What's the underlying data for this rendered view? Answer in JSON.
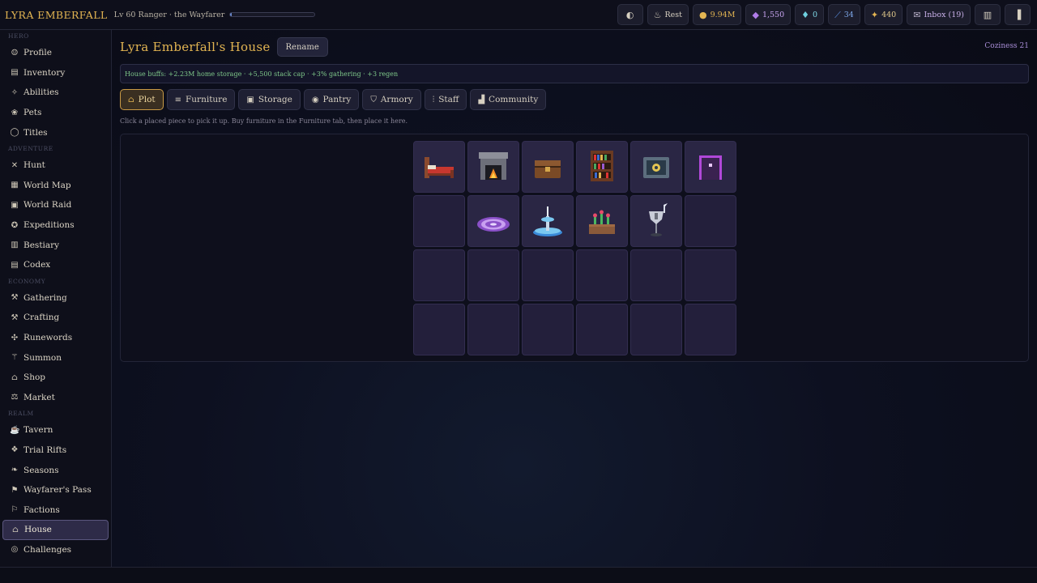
{
  "topbar": {
    "brand": "LYRA EMBERFALL",
    "level": "Lv 60 Ranger · the Wayfarer",
    "xp_fraction": 0.02,
    "rest_label": "Rest",
    "gold": "9.94M",
    "gems": "1,550",
    "crystals": "0",
    "shards": "34",
    "sparks": "440",
    "inbox_label": "Inbox (19)"
  },
  "sidebar": {
    "sections": [
      {
        "label": "HERO",
        "items": [
          {
            "label": "Profile",
            "icon": "person-icon"
          },
          {
            "label": "Inventory",
            "icon": "bag-icon"
          },
          {
            "label": "Abilities",
            "icon": "sparkle-icon"
          },
          {
            "label": "Pets",
            "icon": "paw-icon"
          },
          {
            "label": "Titles",
            "icon": "scroll-icon"
          }
        ]
      },
      {
        "label": "ADVENTURE",
        "items": [
          {
            "label": "Hunt",
            "icon": "swords-icon"
          },
          {
            "label": "World Map",
            "icon": "map-icon"
          },
          {
            "label": "World Raid",
            "icon": "raid-icon"
          },
          {
            "label": "Expeditions",
            "icon": "compass-icon"
          },
          {
            "label": "Bestiary",
            "icon": "book-icon"
          },
          {
            "label": "Codex",
            "icon": "codex-icon"
          }
        ]
      },
      {
        "label": "ECONOMY",
        "items": [
          {
            "label": "Gathering",
            "icon": "pickaxe-icon"
          },
          {
            "label": "Crafting",
            "icon": "hammer-icon"
          },
          {
            "label": "Runewords",
            "icon": "rune-icon"
          },
          {
            "label": "Summon",
            "icon": "wand-icon"
          },
          {
            "label": "Shop",
            "icon": "shop-icon"
          },
          {
            "label": "Market",
            "icon": "scales-icon"
          }
        ]
      },
      {
        "label": "REALM",
        "items": [
          {
            "label": "Tavern",
            "icon": "mug-icon"
          },
          {
            "label": "Trial Rifts",
            "icon": "rift-icon"
          },
          {
            "label": "Seasons",
            "icon": "leaf-icon"
          },
          {
            "label": "Wayfarer's Pass",
            "icon": "ticket-icon"
          },
          {
            "label": "Factions",
            "icon": "banner-icon"
          },
          {
            "label": "House",
            "icon": "house-icon",
            "active": true
          },
          {
            "label": "Challenges",
            "icon": "target-icon"
          }
        ]
      }
    ]
  },
  "house": {
    "title": "Lyra Emberfall's House",
    "rename_label": "Rename",
    "coziness": "Coziness 21",
    "buffs": "House buffs: +2.23M home storage · +5,500 stack cap · +3% gathering · +3 regen",
    "tabs": [
      {
        "label": "Plot",
        "icon": "house-icon",
        "active": true
      },
      {
        "label": "Furniture",
        "icon": "sofa-icon"
      },
      {
        "label": "Storage",
        "icon": "chest-icon"
      },
      {
        "label": "Pantry",
        "icon": "pot-icon"
      },
      {
        "label": "Armory",
        "icon": "armor-icon"
      },
      {
        "label": "Staff",
        "icon": "staff-icon"
      },
      {
        "label": "Community",
        "icon": "community-icon"
      }
    ],
    "hint": "Click a placed piece to pick it up. Buy furniture in the Furniture tab, then place it here.",
    "grid_cols": 6,
    "grid_rows": 4,
    "placed": [
      {
        "row": 0,
        "col": 0,
        "item": "bed"
      },
      {
        "row": 0,
        "col": 1,
        "item": "fireplace"
      },
      {
        "row": 0,
        "col": 2,
        "item": "chest"
      },
      {
        "row": 0,
        "col": 3,
        "item": "bookshelf"
      },
      {
        "row": 0,
        "col": 4,
        "item": "safe"
      },
      {
        "row": 0,
        "col": 5,
        "item": "wardrobe"
      },
      {
        "row": 1,
        "col": 1,
        "item": "rug"
      },
      {
        "row": 1,
        "col": 2,
        "item": "fountain"
      },
      {
        "row": 1,
        "col": 3,
        "item": "planter"
      },
      {
        "row": 1,
        "col": 4,
        "item": "armor-stand"
      }
    ]
  }
}
